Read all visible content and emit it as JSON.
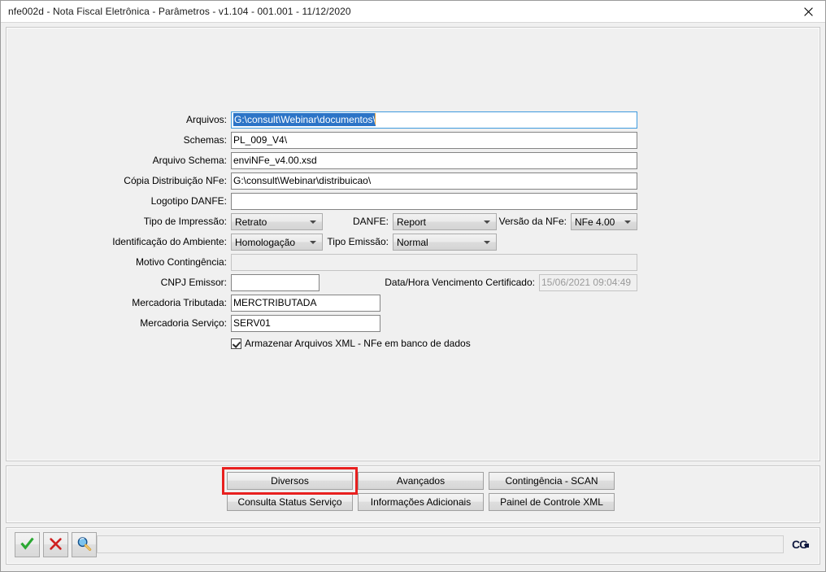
{
  "window": {
    "title": "nfe002d - Nota Fiscal Eletrônica - Parâmetros - v1.104 - 001.001 - 11/12/2020",
    "close_label": "✕"
  },
  "form": {
    "fields": [
      {
        "label": "Arquivos:",
        "value": "G:\\consult\\Webinar\\documentos\\"
      },
      {
        "label": "Schemas:",
        "value": "PL_009_V4\\"
      },
      {
        "label": "Arquivo Schema:",
        "value": "enviNFe_v4.00.xsd"
      },
      {
        "label": "Cópia Distribuição NFe:",
        "value": "G:\\consult\\Webinar\\distribuicao\\"
      },
      {
        "label": "Logotipo DANFE:",
        "value": ""
      },
      {
        "label": "Motivo Contingência:",
        "value": ""
      },
      {
        "label": "CNPJ Emissor:",
        "value": ""
      },
      {
        "label": "Data/Hora Vencimento Certificado:",
        "value": "15/06/2021 09:04:49"
      },
      {
        "label": "Mercadoria Tributada:",
        "value": "MERCTRIBUTADA"
      },
      {
        "label": "Mercadoria Serviço:",
        "value": "SERV01"
      }
    ],
    "combos": [
      {
        "label": "Tipo de Impressão:",
        "value": "Retrato"
      },
      {
        "label": "DANFE:",
        "value": "Report"
      },
      {
        "label": "Versão da NFe:",
        "value": "NFe 4.00"
      },
      {
        "label": "Identificação do Ambiente:",
        "value": "Homologação"
      },
      {
        "label": "Tipo Emissão:",
        "value": "Normal"
      }
    ],
    "checkbox": {
      "label": "Armazenar Arquivos XML - NFe em banco de dados",
      "checked": true
    }
  },
  "buttons": [
    {
      "label": "Diversos",
      "highlighted": true
    },
    {
      "label": "Avançados",
      "highlighted": false
    },
    {
      "label": "Contingência - SCAN",
      "highlighted": false
    },
    {
      "label": "Consulta Status Serviço",
      "highlighted": false
    },
    {
      "label": "Informações Adicionais",
      "highlighted": false
    },
    {
      "label": "Painel de Controle XML",
      "highlighted": false
    }
  ],
  "toolbar": {
    "confirm_icon": "check-icon",
    "cancel_icon": "cross-icon",
    "search_icon": "magnifier-icon",
    "status_value": ""
  },
  "branding": {
    "logo_text": "CG"
  },
  "colors": {
    "selection_blue": "#2c74c7",
    "highlight_red": "#e8201f",
    "confirm_green": "#2aa832",
    "cancel_red": "#cf2020",
    "logo_navy": "#10193f"
  }
}
